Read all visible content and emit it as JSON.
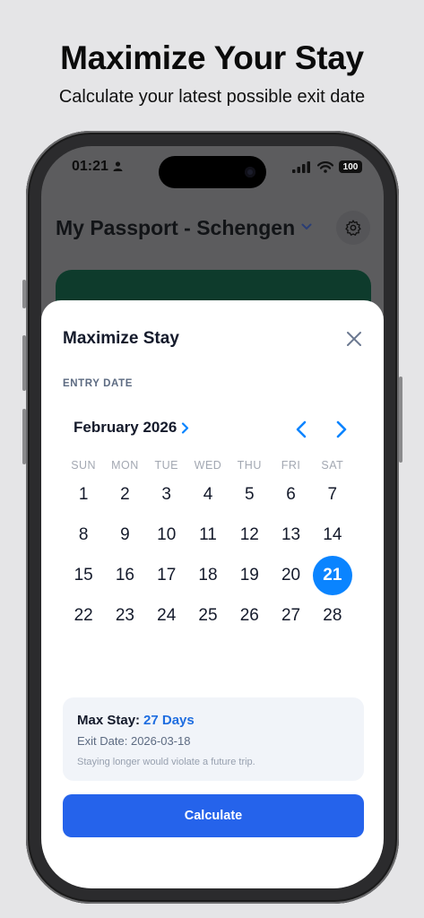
{
  "promo": {
    "headline": "Maximize Your Stay",
    "subheadline": "Calculate your latest possible exit date"
  },
  "status_bar": {
    "time": "01:21",
    "battery": "100",
    "icons": [
      "person-icon",
      "signal-icon",
      "wifi-icon",
      "battery-icon"
    ]
  },
  "app": {
    "passport_title": "My Passport - Schengen",
    "icons": [
      "chevron-down-icon",
      "gear-icon"
    ]
  },
  "sheet": {
    "title": "Maximize Stay",
    "entry_label": "ENTRY DATE",
    "month": "February 2026",
    "weekdays": [
      "SUN",
      "MON",
      "TUE",
      "WED",
      "THU",
      "FRI",
      "SAT"
    ],
    "weeks": [
      [
        "1",
        "2",
        "3",
        "4",
        "5",
        "6",
        "7"
      ],
      [
        "8",
        "9",
        "10",
        "11",
        "12",
        "13",
        "14"
      ],
      [
        "15",
        "16",
        "17",
        "18",
        "19",
        "20",
        "21"
      ],
      [
        "22",
        "23",
        "24",
        "25",
        "26",
        "27",
        "28"
      ]
    ],
    "selected_day": "21",
    "result": {
      "max_stay_label": "Max Stay:",
      "max_stay_value": "27 Days",
      "exit_date": "Exit Date: 2026-03-18",
      "warning": "Staying longer would violate a future trip."
    },
    "calculate_label": "Calculate"
  },
  "colors": {
    "accent": "#0a84ff",
    "button": "#2563eb",
    "highlight_text": "#1e6de0",
    "card_green": "#0e3b2c"
  }
}
